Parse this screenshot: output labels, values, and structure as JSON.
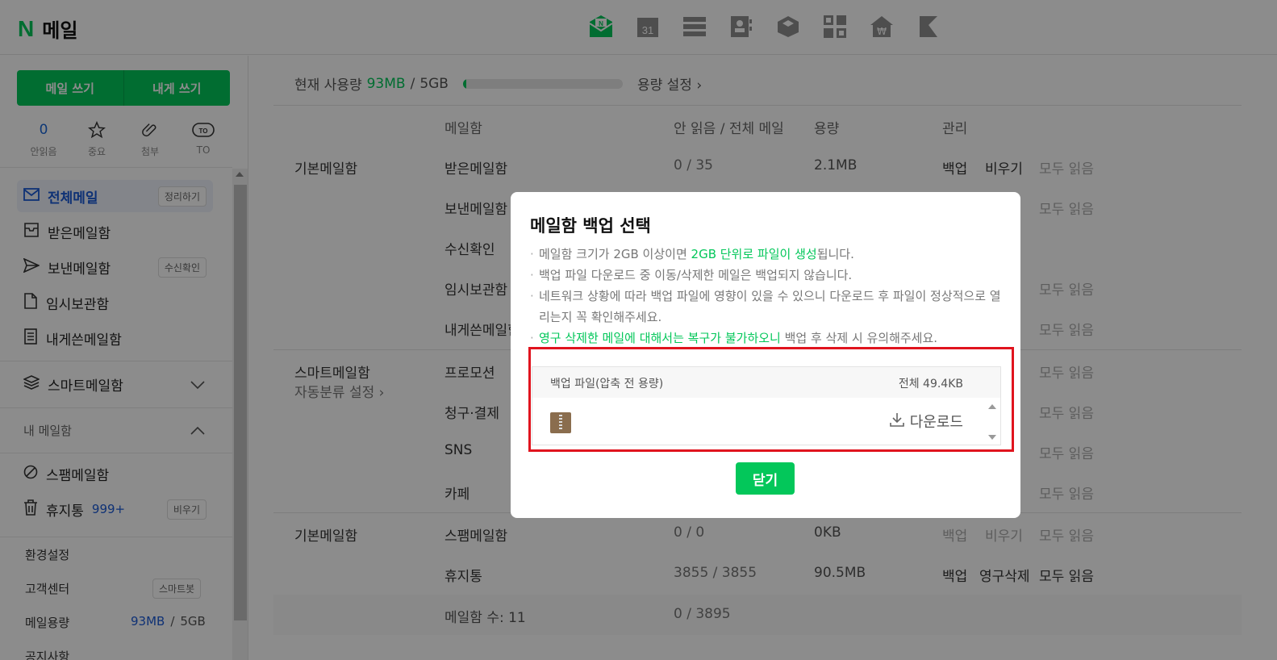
{
  "colors": {
    "accent": "#03c75a",
    "link": "#1b5ad6",
    "highlight_box": "#e0141e"
  },
  "header": {
    "logo_mark": "N",
    "title": "메일",
    "top_icons": [
      "mail-icon",
      "calendar-icon",
      "contacts-list-icon",
      "address-book-icon",
      "box-icon",
      "apps-icon",
      "pay-icon",
      "bookmark-icon"
    ],
    "calendar_num": "31"
  },
  "sidebar": {
    "write_label": "메일 쓰기",
    "self_write_label": "내게 쓰기",
    "quick": [
      {
        "value": "0",
        "label": "안읽음"
      },
      {
        "label": "중요"
      },
      {
        "label": "첨부"
      },
      {
        "label": "TO"
      }
    ],
    "items": [
      {
        "label": "전체메일",
        "badge": "정리하기"
      },
      {
        "label": "받은메일함"
      },
      {
        "label": "보낸메일함",
        "badge": "수신확인"
      },
      {
        "label": "임시보관함"
      },
      {
        "label": "내게쓴메일함"
      },
      {
        "label": "스마트메일함"
      }
    ],
    "my_mailbox": "내 메일함",
    "spam": "스팸메일함",
    "trash": "휴지통",
    "trash_count": "999+",
    "trash_badge": "비우기",
    "settings": "환경설정",
    "support": "고객센터",
    "support_badge": "스마트봇",
    "capacity_label": "메일용량",
    "capacity_used": "93MB",
    "capacity_sep": "/",
    "capacity_total": "5GB",
    "cutoff": "공지사항"
  },
  "main": {
    "usage_label": "현재 사용량",
    "usage_used": "93MB",
    "usage_sep": "/",
    "usage_total": "5GB",
    "usage_fraction": 0.02,
    "usage_setting": "용량 설정 ›",
    "headers": {
      "box": "메일함",
      "unread": "안 읽음 / 전체 메일",
      "size": "용량",
      "manage": "관리"
    },
    "rows": [
      {
        "group": "기본메일함",
        "name": "받은메일함",
        "count": "0 / 35",
        "size": "2.1MB",
        "a1": "백업",
        "a2": "비우기",
        "a3": "모두 읽음"
      },
      {
        "name": "보낸메일함",
        "a3": "모두 읽음"
      },
      {
        "name": "수신확인"
      },
      {
        "name": "임시보관함",
        "a3": "모두 읽음"
      },
      {
        "name": "내게쓴메일함",
        "a3": "모두 읽음"
      },
      {
        "group": "스마트메일함",
        "sub": "자동분류 설정 ›",
        "name": "프로모션",
        "a3": "모두 읽음"
      },
      {
        "name": "청구·결제",
        "a3": "모두 읽음"
      },
      {
        "name": "SNS",
        "a3": "모두 읽음"
      },
      {
        "name": "카페",
        "a3": "모두 읽음"
      },
      {
        "group": "기본메일함",
        "name": "스팸메일함",
        "count": "0 / 0",
        "size": "0KB",
        "a1": "백업",
        "a2": "비우기",
        "a3": "모두 읽음"
      },
      {
        "name": "휴지통",
        "count": "3855 / 3855",
        "size": "90.5MB",
        "a1": "백업",
        "a2": "영구삭제",
        "a3": "모두 읽음"
      },
      {
        "name": "메일함 수: 11",
        "count": "0 / 3895"
      }
    ]
  },
  "modal": {
    "title": "메일함 백업 선택",
    "note1_a": "메일함 크기가 2GB 이상이면 ",
    "note1_hl": "2GB 단위로 파일이 생성",
    "note1_b": "됩니다.",
    "note2": "백업 파일 다운로드 중 이동/삭제한 메일은 백업되지 않습니다.",
    "note3": "네트워크 상황에 따라 백업 파일에 영향이 있을 수 있으니 다운로드 후 파일이 정상적으로 열리는지 꼭 확인해주세요.",
    "note4_hl": "영구 삭제한 메일에 대해서는 복구가 불가하오니",
    "note4_b": " 백업 후 삭제 시 유의해주세요.",
    "file_header": "백업 파일(압축 전 용량)",
    "total": "전체 49.4KB",
    "download": "다운로드",
    "close": "닫기"
  }
}
